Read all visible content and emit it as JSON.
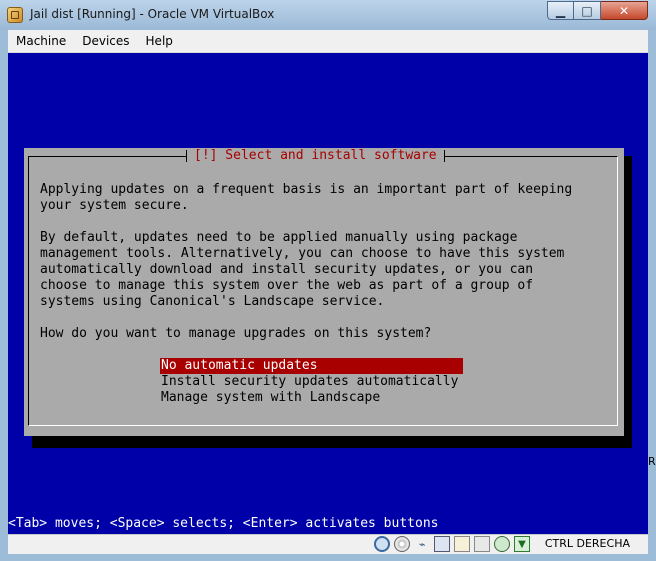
{
  "window": {
    "title": "Jail dist [Running] - Oracle VM VirtualBox",
    "minimize_glyph": "▁",
    "maximize_glyph": "□",
    "close_glyph": "✕"
  },
  "menubar": {
    "items": [
      "Machine",
      "Devices",
      "Help"
    ]
  },
  "dialog": {
    "title": "[!] Select and install software",
    "para1": "Applying updates on a frequent basis is an important part of keeping\nyour system secure.",
    "para2": "By default, updates need to be applied manually using package\nmanagement tools. Alternatively, you can choose to have this system\nautomatically download and install security updates, or you can\nchoose to manage this system over the web as part of a group of\nsystems using Canonical's Landscape service.",
    "question": "How do you want to manage upgrades on this system?",
    "options": [
      "No automatic updates",
      "Install security updates automatically",
      "Manage system with Landscape"
    ],
    "selected_index": 0
  },
  "statusline": "<Tab> moves; <Space> selects; <Enter> activates buttons",
  "statusbar": {
    "host_key": "CTRL DERECHA",
    "icons": [
      "hard-disk-icon",
      "optical-drive-icon",
      "usb-icon",
      "network-icon",
      "shared-folders-icon",
      "video-capture-icon",
      "mouse-integration-icon",
      "host-key-indicator-icon"
    ]
  },
  "side_fragment": "RL"
}
